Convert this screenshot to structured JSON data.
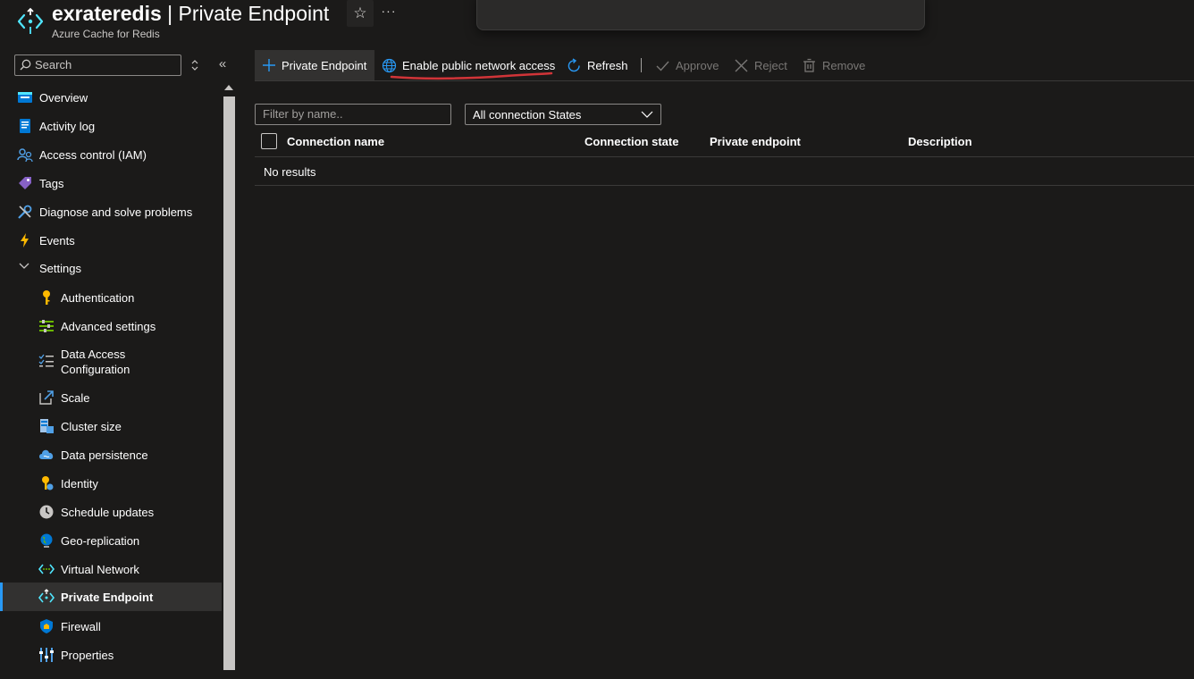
{
  "header": {
    "resource_name": "exrateredis",
    "separator": " | ",
    "page_name": "Private Endpoint",
    "resource_type": "Azure Cache for Redis",
    "favorite_icon": "star-icon",
    "more_label": "···"
  },
  "search": {
    "placeholder": "Search"
  },
  "sidebar": {
    "items": [
      {
        "label": "Overview",
        "icon": "overview-icon"
      },
      {
        "label": "Activity log",
        "icon": "activity-log-icon"
      },
      {
        "label": "Access control (IAM)",
        "icon": "iam-icon"
      },
      {
        "label": "Tags",
        "icon": "tag-icon"
      },
      {
        "label": "Diagnose and solve problems",
        "icon": "wrench-icon"
      },
      {
        "label": "Events",
        "icon": "lightning-icon"
      },
      {
        "label": "Settings",
        "icon": "chevron-down-icon"
      }
    ],
    "settings_items": [
      {
        "label": "Authentication",
        "icon": "key-icon"
      },
      {
        "label": "Advanced settings",
        "icon": "sliders-icon"
      },
      {
        "label": "Data Access",
        "label2": "Configuration",
        "icon": "checklist-icon"
      },
      {
        "label": "Scale",
        "icon": "scale-icon"
      },
      {
        "label": "Cluster size",
        "icon": "cluster-icon"
      },
      {
        "label": "Data persistence",
        "icon": "cloud-icon"
      },
      {
        "label": "Identity",
        "icon": "identity-icon"
      },
      {
        "label": "Schedule updates",
        "icon": "clock-icon"
      },
      {
        "label": "Geo-replication",
        "icon": "globe-icon"
      },
      {
        "label": "Virtual Network",
        "icon": "vnet-icon"
      },
      {
        "label": "Private Endpoint",
        "icon": "private-endpoint-icon",
        "active": true
      },
      {
        "label": "Firewall",
        "icon": "shield-icon"
      },
      {
        "label": "Properties",
        "icon": "properties-icon"
      }
    ]
  },
  "toolbar": {
    "private_endpoint": "Private Endpoint",
    "enable_public": "Enable public network access",
    "refresh": "Refresh",
    "approve": "Approve",
    "reject": "Reject",
    "remove": "Remove"
  },
  "filters": {
    "name_placeholder": "Filter by name..",
    "state_value": "All connection States"
  },
  "table": {
    "columns": [
      "Connection name",
      "Connection state",
      "Private endpoint",
      "Description"
    ],
    "empty_text": "No results"
  },
  "colors": {
    "accent": "#2899f5",
    "annotation": "#d13438",
    "background": "#1b1a19"
  }
}
